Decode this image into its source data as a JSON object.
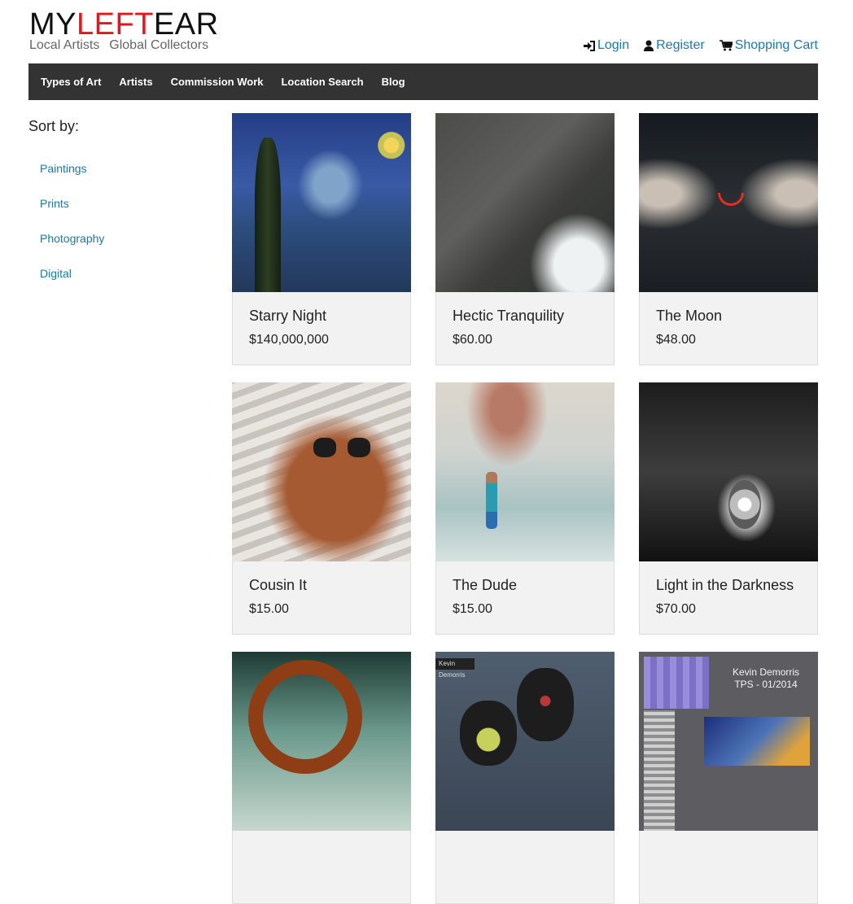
{
  "header": {
    "logo": {
      "part1": "MY",
      "part2": "LEFT",
      "part3": "EAR"
    },
    "tagline": {
      "left": "Local Artists",
      "right": "Global Collectors"
    },
    "links": {
      "login": "Login",
      "register": "Register",
      "cart": "Shopping Cart"
    }
  },
  "nav": [
    "Types of Art",
    "Artists",
    "Commission Work",
    "Location Search",
    "Blog"
  ],
  "sidebar": {
    "title": "Sort by:",
    "items": [
      "Paintings",
      "Prints",
      "Photography",
      "Digital"
    ]
  },
  "products": [
    {
      "title": "Starry Night",
      "price": "$140,000,000"
    },
    {
      "title": "Hectic Tranquility",
      "price": "$60.00"
    },
    {
      "title": "The Moon",
      "price": "$48.00"
    },
    {
      "title": "Cousin It",
      "price": "$15.00"
    },
    {
      "title": "The Dude",
      "price": "$15.00"
    },
    {
      "title": "Light in the Darkness",
      "price": "$70.00"
    }
  ],
  "partial_art": {
    "tag": "Kevin Demorris",
    "label_line1": "Kevin  Demorris",
    "label_line2": "TPS - 01/2014"
  },
  "colors": {
    "accent": "#e8141b",
    "link": "#1b7aa6",
    "navbar": "#333333"
  }
}
